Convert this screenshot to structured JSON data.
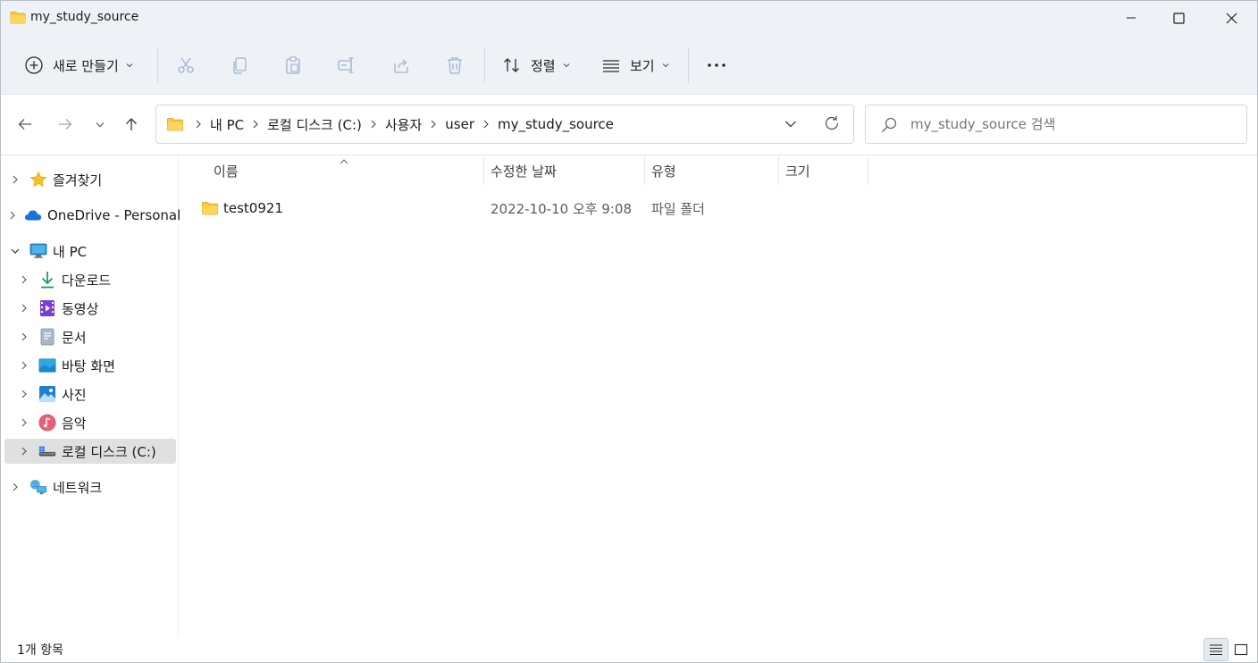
{
  "window": {
    "title": "my_study_source"
  },
  "toolbar": {
    "new_label": "새로 만들기",
    "sort_label": "정렬",
    "view_label": "보기",
    "more_label": "•••"
  },
  "address": {
    "crumbs": [
      "내 PC",
      "로컬 디스크 (C:)",
      "사용자",
      "user",
      "my_study_source"
    ]
  },
  "search": {
    "placeholder": "my_study_source 검색"
  },
  "sidebar": {
    "items": [
      {
        "label": "즐겨찾기",
        "icon": "star-icon"
      },
      {
        "label": "OneDrive - Personal",
        "icon": "cloud-icon"
      },
      {
        "label": "내 PC",
        "icon": "monitor-icon"
      },
      {
        "label": "다운로드",
        "icon": "download-icon"
      },
      {
        "label": "동영상",
        "icon": "video-icon"
      },
      {
        "label": "문서",
        "icon": "document-icon"
      },
      {
        "label": "바탕 화면",
        "icon": "desktop-icon"
      },
      {
        "label": "사진",
        "icon": "pictures-icon"
      },
      {
        "label": "음악",
        "icon": "music-icon"
      },
      {
        "label": "로컬 디스크 (C:)",
        "icon": "drive-icon"
      },
      {
        "label": "네트워크",
        "icon": "network-icon"
      }
    ]
  },
  "columns": {
    "name": "이름",
    "modified": "수정한 날짜",
    "type": "유형",
    "size": "크기"
  },
  "files": [
    {
      "name": "test0921",
      "modified": "2022-10-10 오후 9:08",
      "type": "파일 폴더",
      "size": ""
    }
  ],
  "status": {
    "count": "1개 항목"
  },
  "colors": {
    "chrome_bg": "#eef2f6",
    "folder_yellow": "#f8c93a",
    "accent": "#0a64c8"
  }
}
